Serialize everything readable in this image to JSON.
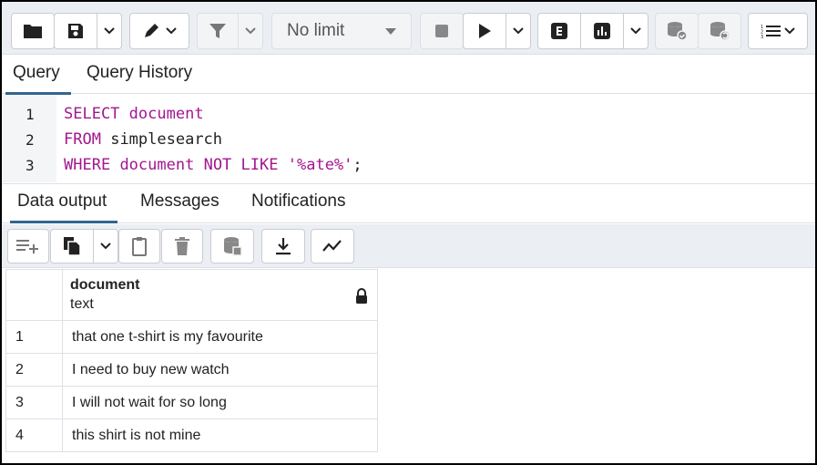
{
  "toolbar": {
    "limit_label": "No limit"
  },
  "query_tabs": [
    {
      "label": "Query"
    },
    {
      "label": "Query History"
    }
  ],
  "editor": {
    "line_numbers": [
      "1",
      "2",
      "3"
    ],
    "line1": {
      "kw1": "SELECT",
      "kw2": "document"
    },
    "line2": {
      "kw": "FROM",
      "rest": "simplesearch"
    },
    "line3": {
      "kw1": "WHERE",
      "kw2": "document",
      "kw3": "NOT",
      "kw4": "LIKE",
      "str": "'%ate%'",
      "end": ";"
    }
  },
  "result_tabs": [
    {
      "label": "Data output"
    },
    {
      "label": "Messages"
    },
    {
      "label": "Notifications"
    }
  ],
  "grid": {
    "column": {
      "name": "document",
      "type": "text"
    },
    "rows": [
      {
        "n": "1",
        "value": "that one t-shirt is my favourite"
      },
      {
        "n": "2",
        "value": "I need to buy new watch"
      },
      {
        "n": "3",
        "value": "I will not wait for so long"
      },
      {
        "n": "4",
        "value": "this shirt is not mine"
      }
    ]
  },
  "colors": {
    "keyword": "#a3168f",
    "tab_underline": "#326690",
    "toolbar_bg": "#ebeef3"
  }
}
